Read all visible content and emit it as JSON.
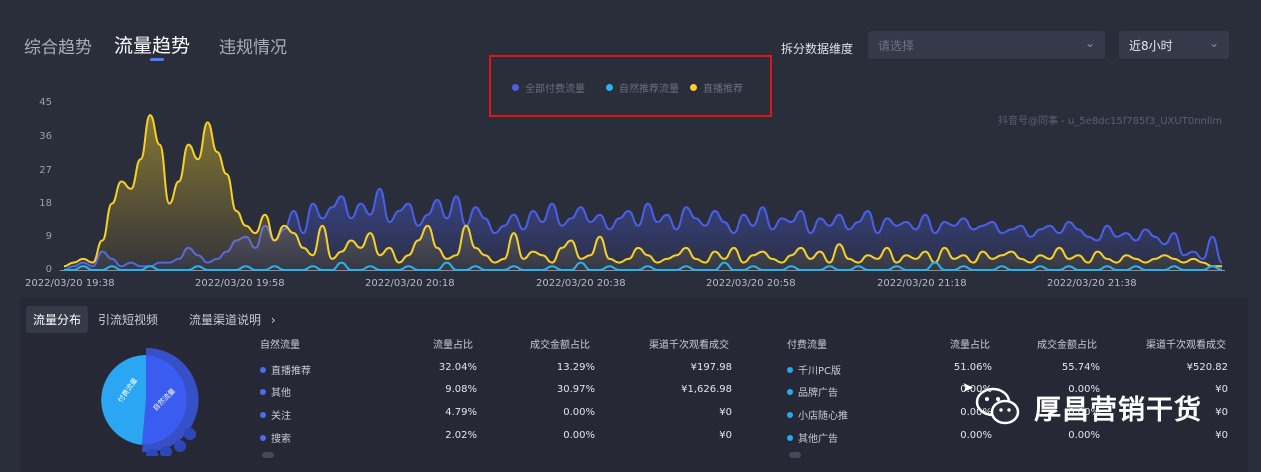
{
  "tabs": [
    {
      "label": "综合趋势",
      "active": false
    },
    {
      "label": "流量趋势",
      "active": true
    },
    {
      "label": "违规情况",
      "active": false
    }
  ],
  "dimension": {
    "label": "拆分数据维度",
    "placeholder": "请选择",
    "time_range": "近8小时"
  },
  "legend": [
    {
      "label": "全部付费流量",
      "color": "#4a5fe8"
    },
    {
      "label": "自然推荐流量",
      "color": "#27b3f0"
    },
    {
      "label": "直播推荐",
      "color": "#f5d02a"
    }
  ],
  "watermark_top": "抖音号@同事 - u_5e8dc15f785f3_UXUT0nnllm",
  "chart_data": {
    "type": "line",
    "ylim": [
      0,
      45
    ],
    "yticks": [
      "45",
      "36",
      "27",
      "18",
      "9",
      "0"
    ],
    "xticks": [
      "2022/03/20 19:38",
      "2022/03/20 19:58",
      "2022/03/20 20:18",
      "2022/03/20 20:38",
      "2022/03/20 20:58",
      "2022/03/20 21:18",
      "2022/03/20 21:38"
    ],
    "series": [
      {
        "name": "全部付费流量",
        "color": "#4a5fe8",
        "values": [
          0,
          1,
          2,
          1,
          5,
          3,
          1,
          2,
          1,
          1,
          2,
          2,
          3,
          6,
          4,
          2,
          3,
          5,
          8,
          9,
          6,
          12,
          8,
          11,
          16,
          10,
          18,
          14,
          17,
          20,
          14,
          18,
          15,
          22,
          13,
          16,
          18,
          12,
          15,
          19,
          14,
          20,
          12,
          17,
          14,
          10,
          12,
          15,
          11,
          16,
          13,
          18,
          12,
          14,
          17,
          13,
          15,
          11,
          14,
          16,
          12,
          18,
          13,
          15,
          11,
          17,
          14,
          12,
          16,
          13,
          10,
          15,
          12,
          17,
          11,
          14,
          13,
          16,
          10,
          14,
          12,
          15,
          11,
          13,
          16,
          10,
          14,
          12,
          13,
          11,
          15,
          10,
          13,
          12,
          14,
          11,
          12,
          13,
          10,
          11,
          12,
          9,
          11,
          12,
          10,
          13,
          11,
          9,
          8,
          12,
          9,
          10,
          8,
          11,
          9,
          7,
          10,
          4,
          5,
          3,
          9,
          2
        ]
      },
      {
        "name": "自然推荐流量",
        "color": "#27b3f0",
        "values": [
          0,
          0,
          1,
          0,
          0,
          1,
          0,
          0,
          0,
          1,
          0,
          0,
          0,
          0,
          1,
          0,
          0,
          0,
          0,
          1,
          0,
          0,
          1,
          0,
          0,
          0,
          1,
          0,
          0,
          2,
          0,
          0,
          1,
          0,
          0,
          0,
          1,
          0,
          0,
          0,
          2,
          0,
          0,
          1,
          0,
          0,
          0,
          1,
          0,
          0,
          0,
          1,
          0,
          0,
          2,
          0,
          0,
          1,
          0,
          0,
          0,
          1,
          0,
          0,
          0,
          1,
          0,
          0,
          0,
          2,
          0,
          0,
          1,
          0,
          0,
          0,
          1,
          0,
          0,
          0,
          1,
          0,
          0,
          1,
          0,
          0,
          0,
          1,
          0,
          0,
          0,
          2,
          0,
          0,
          1,
          0,
          0,
          0,
          1,
          0,
          0,
          0,
          1,
          0,
          0,
          1,
          0,
          0,
          0,
          1,
          0,
          0,
          1,
          0,
          0,
          0,
          1,
          0,
          0,
          0,
          1,
          0
        ]
      },
      {
        "name": "直播推荐",
        "color": "#f5d02a",
        "values": [
          1,
          2,
          3,
          2,
          8,
          18,
          24,
          22,
          30,
          42,
          34,
          18,
          24,
          34,
          30,
          40,
          32,
          26,
          16,
          12,
          10,
          15,
          8,
          12,
          10,
          6,
          4,
          12,
          3,
          5,
          8,
          6,
          10,
          4,
          6,
          2,
          4,
          8,
          12,
          6,
          3,
          4,
          12,
          6,
          4,
          2,
          3,
          10,
          3,
          5,
          4,
          2,
          6,
          8,
          3,
          4,
          9,
          3,
          2,
          3,
          6,
          4,
          2,
          3,
          4,
          6,
          3,
          2,
          5,
          3,
          6,
          2,
          4,
          5,
          3,
          2,
          4,
          6,
          3,
          5,
          2,
          7,
          3,
          2,
          4,
          3,
          6,
          2,
          4,
          3,
          5,
          2,
          6,
          3,
          4,
          2,
          5,
          3,
          4,
          5,
          3,
          2,
          4,
          3,
          6,
          3,
          4,
          2,
          5,
          3,
          2,
          4,
          3,
          2,
          3,
          4,
          3,
          2,
          3,
          2,
          1,
          1
        ]
      }
    ]
  },
  "subtabs": [
    "流量分布",
    "引流短视频",
    "流量渠道说明"
  ],
  "donut": {
    "label_paid": "付费流量",
    "label_natural": "自然流量"
  },
  "natural": {
    "headers": [
      "自然流量",
      "流量占比",
      "成交金额占比",
      "渠道千次观看成交"
    ],
    "rows": [
      {
        "name": "直播推荐",
        "share": "32.04%",
        "gmv": "13.29%",
        "gpm": "¥197.98",
        "color": "#4a6cf2"
      },
      {
        "name": "其他",
        "share": "9.08%",
        "gmv": "30.97%",
        "gpm": "¥1,626.98",
        "color": "#4a6cf2"
      },
      {
        "name": "关注",
        "share": "4.79%",
        "gmv": "0.00%",
        "gpm": "¥0",
        "color": "#4a6cf2"
      },
      {
        "name": "搜索",
        "share": "2.02%",
        "gmv": "0.00%",
        "gpm": "¥0",
        "color": "#4a6cf2"
      }
    ]
  },
  "paid": {
    "headers": [
      "付费流量",
      "流量占比",
      "成交金额占比",
      "渠道千次观看成交"
    ],
    "rows": [
      {
        "name": "千川PC版",
        "share": "51.06%",
        "gmv": "55.74%",
        "gpm": "¥520.82",
        "color": "#27a8f0"
      },
      {
        "name": "品牌广告",
        "share": "0.00%",
        "gmv": "0.00%",
        "gpm": "¥0",
        "color": "#27a8f0"
      },
      {
        "name": "小店随心推",
        "share": "0.00%",
        "gmv": "0.00%",
        "gpm": "¥0",
        "color": "#27a8f0"
      },
      {
        "name": "其他广告",
        "share": "0.00%",
        "gmv": "0.00%",
        "gpm": "¥0",
        "color": "#27a8f0"
      }
    ]
  },
  "watermark": "厚昌营销干货"
}
